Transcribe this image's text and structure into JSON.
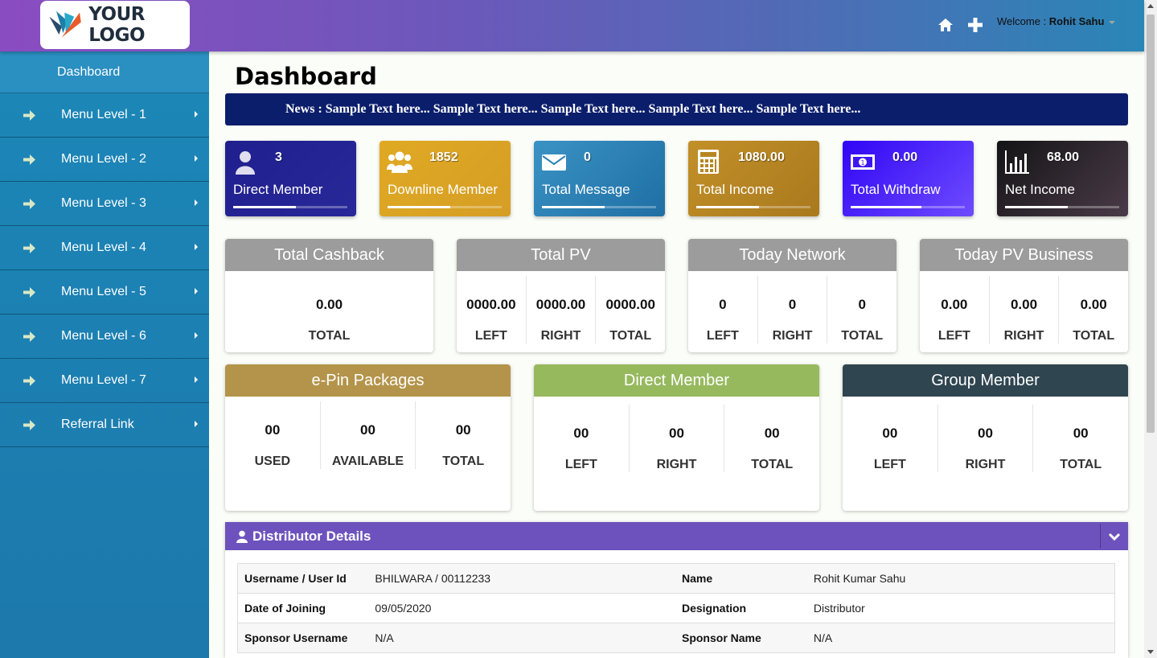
{
  "header": {
    "logo_text": "YOUR LOGO",
    "welcome_prefix": "Welcome : ",
    "user_name": "Rohit Sahu"
  },
  "sidebar": {
    "dashboard": "Dashboard",
    "items": [
      {
        "label": "Menu Level - 1"
      },
      {
        "label": "Menu Level - 2"
      },
      {
        "label": "Menu Level - 3"
      },
      {
        "label": "Menu Level - 4"
      },
      {
        "label": "Menu Level - 5"
      },
      {
        "label": "Menu Level - 6"
      },
      {
        "label": "Menu Level - 7"
      },
      {
        "label": "Referral Link"
      }
    ]
  },
  "main": {
    "title": "Dashboard",
    "news": "News : Sample Text here... Sample Text here... Sample Text here... Sample Text here... Sample Text here..."
  },
  "stats": [
    {
      "value": "3",
      "label": "Direct Member",
      "icon": "user-icon",
      "progress": 0.55,
      "color": "#1f1f8e"
    },
    {
      "value": "1852",
      "label": "Downline Member",
      "icon": "users-icon",
      "progress": 0.55,
      "color": "#d9a322"
    },
    {
      "value": "0",
      "label": "Total Message",
      "icon": "envelope-icon",
      "progress": 0.55,
      "color": "#2c82b5"
    },
    {
      "value": "1080.00",
      "label": "Total Income",
      "icon": "calculator-icon",
      "progress": 0.55,
      "color": "#b78623"
    },
    {
      "value": "0.00",
      "label": "Total Withdraw",
      "icon": "money-icon",
      "progress": 0.62,
      "color": "#3f16f2"
    },
    {
      "value": "68.00",
      "label": "Net Income",
      "icon": "bar-chart-icon",
      "progress": 0.55,
      "color": "#1e1e20"
    }
  ],
  "cards_row1": [
    {
      "title": "Total Cashback",
      "cols": [
        {
          "v": "0.00",
          "l": "TOTAL"
        }
      ]
    },
    {
      "title": "Total PV",
      "cols": [
        {
          "v": "0000.00",
          "l": "LEFT"
        },
        {
          "v": "0000.00",
          "l": "RIGHT"
        },
        {
          "v": "0000.00",
          "l": "TOTAL"
        }
      ]
    },
    {
      "title": "Today Network",
      "cols": [
        {
          "v": "0",
          "l": "LEFT"
        },
        {
          "v": "0",
          "l": "RIGHT"
        },
        {
          "v": "0",
          "l": "TOTAL"
        }
      ]
    },
    {
      "title": "Today PV Business",
      "cols": [
        {
          "v": "0.00",
          "l": "LEFT"
        },
        {
          "v": "0.00",
          "l": "RIGHT"
        },
        {
          "v": "0.00",
          "l": "TOTAL"
        }
      ]
    }
  ],
  "cards_row2": [
    {
      "title": "e-Pin Packages",
      "color": "#b4944a",
      "cols": [
        {
          "v": "00",
          "l": "USED"
        },
        {
          "v": "00",
          "l": "AVAILABLE"
        },
        {
          "v": "00",
          "l": "TOTAL"
        }
      ]
    },
    {
      "title": "Direct Member",
      "color": "#96b95e",
      "cols": [
        {
          "v": "00",
          "l": "LEFT"
        },
        {
          "v": "00",
          "l": "RIGHT"
        },
        {
          "v": "00",
          "l": "TOTAL"
        }
      ]
    },
    {
      "title": "Group Member",
      "color": "#2f4550",
      "cols": [
        {
          "v": "00",
          "l": "LEFT"
        },
        {
          "v": "00",
          "l": "RIGHT"
        },
        {
          "v": "00",
          "l": "TOTAL"
        }
      ]
    }
  ],
  "distributor": {
    "title": "Distributor Details",
    "rows": [
      [
        "Username / User Id",
        "BHILWARA / 00112233",
        "Name",
        "Rohit Kumar Sahu"
      ],
      [
        "Date of Joining",
        "09/05/2020",
        "Designation",
        "Distributor"
      ],
      [
        "Sponsor Username",
        "N/A",
        "Sponsor Name",
        "N/A"
      ]
    ]
  }
}
